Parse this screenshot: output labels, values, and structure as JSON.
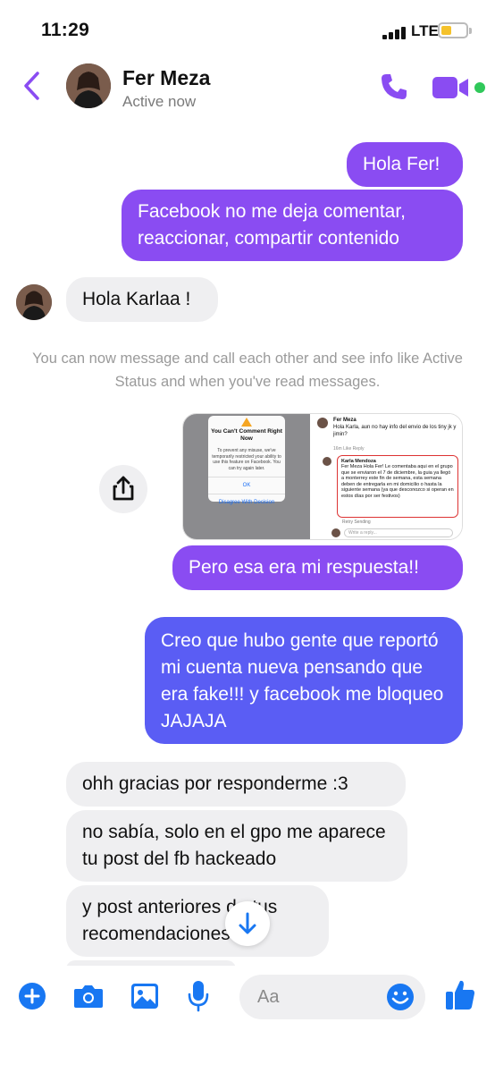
{
  "status_bar": {
    "time": "11:29",
    "network": "LTE"
  },
  "header": {
    "name": "Fer Meza",
    "status": "Active now"
  },
  "messages": {
    "out1": "Hola Fer!",
    "out2": "Facebook no me deja comentar, reaccionar, compartir contenido",
    "in1": "Hola Karlaa !",
    "system_note": "You can now message and call each other and see info like Active Status and when you've read messages.",
    "out3": "Pero esa era mi respuesta!!",
    "out4": "Creo que hubo gente que reportó mi cuenta nueva pensando que era fake!!! y facebook me bloqueo JAJAJA",
    "in2": "ohh gracias por responderme :3",
    "in3": "no sabía, solo en el gpo me aparece tu post del fb hackeado",
    "in4": "y post anteriores de tus recomendaciones"
  },
  "attachment": {
    "left_modal_title": "You Can't Comment Right Now",
    "left_modal_body": "To prevent any misuse, we've temporarily restricted your ability to use this feature on Facebook. You can try again later.",
    "left_modal_ok": "OK",
    "left_modal_disagree": "Disagree With Decision",
    "right_name1": "Fer Meza",
    "right_text1": "Hola Karla, aun no hay info del envio de los tiny jk y jimin?",
    "right_meta": "16m   Like   Reply",
    "right_name2": "Karla Mendoza",
    "right_text2": "Fer Meza Hola Fer! Le comentaba aqui en el grupo que se enviaron el 7 de diciembre, la guia ya llegó a monterrey este fin de semana, esta semana deben de entregarla en mi domicilio o hasta la siguiente semana (ya que desconozco si operan en estos días por ser festivos)",
    "right_retry": "Retry Sending",
    "right_reply_placeholder": "Write a reply..."
  },
  "composer": {
    "placeholder": "Aa"
  },
  "colors": {
    "accent": "#8a4cf2",
    "bubble_out_top": "#8a4cf2",
    "bubble_out_bottom": "#5a5df4",
    "bubble_in": "#efeff1",
    "composer_icon": "#1877f2",
    "active_dot": "#30c85a"
  },
  "icons": {
    "back": "chevron-left-icon",
    "call": "phone-icon",
    "video": "video-camera-icon",
    "share": "share-icon",
    "scroll": "arrow-down-icon",
    "plus": "plus-circle-icon",
    "camera": "camera-icon",
    "gallery": "image-icon",
    "mic": "microphone-icon",
    "emoji": "smiley-icon",
    "like": "thumbs-up-icon"
  }
}
